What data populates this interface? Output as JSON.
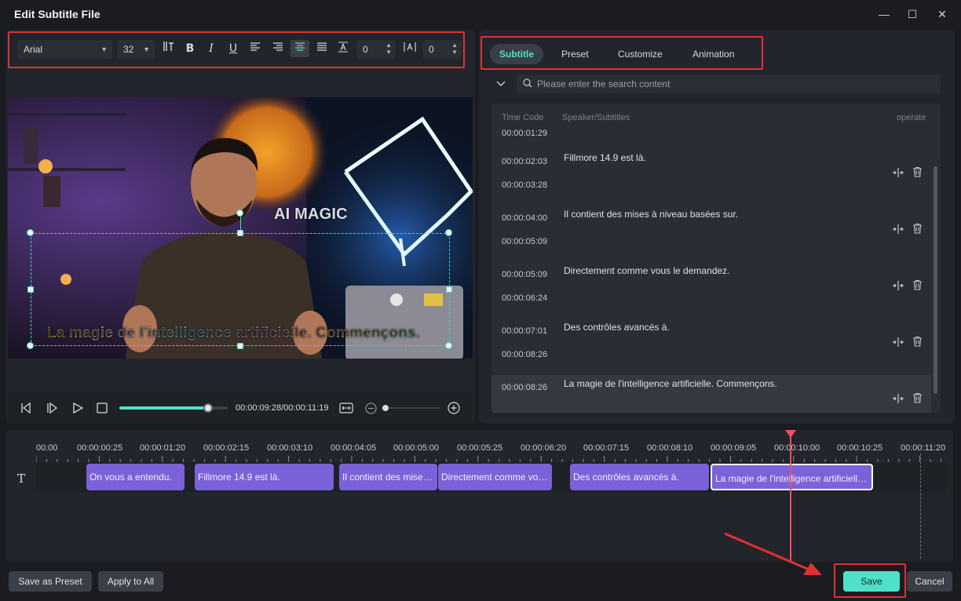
{
  "window": {
    "title": "Edit Subtitle File",
    "minimize": "—",
    "maximize": "☐",
    "close": "✕"
  },
  "toolbar": {
    "font": "Arial",
    "size": "32",
    "letter_spacing": "0",
    "line_spacing": "0",
    "icons": [
      "text-spacing-icon",
      "bold-icon",
      "italic-icon",
      "underline-icon",
      "align-left-icon",
      "align-center-icon",
      "align-right-icon",
      "align-justify-icon",
      "text-baseline-icon",
      "line-height-icon"
    ]
  },
  "preview": {
    "overlay_title": "AI MAGIC",
    "subtitle": "La magie de l'intelligence artificielle. Commençons.",
    "time": "00:00:09:28/00:00:11:19",
    "progress": 0.82
  },
  "tabs": [
    {
      "label": "Subtitle",
      "active": true
    },
    {
      "label": "Preset",
      "active": false
    },
    {
      "label": "Customize",
      "active": false
    },
    {
      "label": "Animation",
      "active": false
    }
  ],
  "search": {
    "placeholder": "Please enter the search content"
  },
  "table": {
    "headers": {
      "time": "Time Code",
      "text": "Speaker/Subtitles",
      "op": "operate"
    },
    "partial_end": "00:00:01:29",
    "rows": [
      {
        "start": "00:00:02:03",
        "end": "00:00:03:28",
        "text": "Fillmore 14.9 est là."
      },
      {
        "start": "00:00:04:00",
        "end": "00:00:05:09",
        "text": "Il contient des mises à niveau basées sur."
      },
      {
        "start": "00:00:05:09",
        "end": "00:00:06:24",
        "text": "Directement comme vous le demandez."
      },
      {
        "start": "00:00:07:01",
        "end": "00:00:08:26",
        "text": "Des contrôles avancés à."
      },
      {
        "start": "00:00:08:26",
        "end": "",
        "text": "La magie de l'intelligence artificielle. Commençons."
      }
    ]
  },
  "timeline": {
    "ruler": [
      "00:00",
      "00:00:00:25",
      "00:00:01:20",
      "00:00:02:15",
      "00:00:03:10",
      "00:00:04:05",
      "00:00:05:00",
      "00:00:05:25",
      "00:00:06:20",
      "00:00:07:15",
      "00:00:08:10",
      "00:00:09:05",
      "00:00:10:00",
      "00:00:10:25",
      "00:00:11:20"
    ],
    "clips": [
      "On vous a entendu.",
      "Fillmore 14.9 est là.",
      "Il contient des mises à niveau basées sur.",
      "Directement comme vous le demandez.",
      "Des contrôles avancés à.",
      "La magie de l'intelligence artificielle. Commençons."
    ]
  },
  "footer": {
    "save_preset": "Save as Preset",
    "apply_all": "Apply to All",
    "save": "Save",
    "cancel": "Cancel"
  },
  "colors": {
    "accent": "#4fe0c8",
    "clip": "#7b62d8",
    "highlight": "#e03131",
    "playhead": "#f05060"
  }
}
